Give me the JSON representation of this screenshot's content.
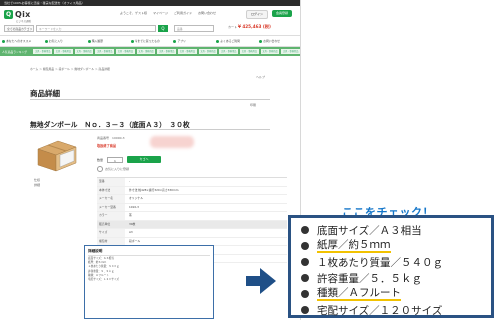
{
  "topbar": {
    "text": "当社で100%お客様に迅速・確実な配送を（オフィス用品）"
  },
  "logo": {
    "mark": "Q",
    "text": "Qix",
    "sub": "ビジネス通販"
  },
  "header": {
    "links": [
      "ようこそ、ゲスト様",
      "マイページ",
      "ご利用ガイド",
      "お問い合わせ"
    ],
    "login": "ログイン",
    "register": "会員登録"
  },
  "search": {
    "category": "全ての商品カテゴリー",
    "placeholder": "キーワードを入力",
    "button": "Q",
    "number_placeholder": "品番"
  },
  "cart": {
    "label": "カート",
    "amount": "¥ 425,463 (税)"
  },
  "nav": [
    "あなたへのオススメ",
    "お気に入り",
    "購入履歴",
    "今までに買ったもの",
    "アプリ",
    "よくあるご質問",
    "お問い合わせ"
  ],
  "categories": {
    "first": "人気商品ランキング",
    "items": [
      "文具・事務用品",
      "文具・事務用品",
      "文具・事務用品",
      "文具・事務用品",
      "文具・事務用品",
      "文具・事務用品",
      "文具・事務用品",
      "文具・事務用品",
      "文具・事務用品",
      "文具・事務用品",
      "文具・事務用品",
      "文具・事務用品",
      "文具・事務用品"
    ]
  },
  "breadcrumb": "ホーム ＞ 梱包用品 ＞ 段ボール ＞ 無地ダンボール ＞ 商品詳細",
  "help": "ヘルプ",
  "page_title": "商品詳細",
  "print_link": "印刷",
  "product": {
    "name": "無地ダンボール　Ｎｏ．３－３（底面Ａ３）　３０枚",
    "code_label": "商品番号",
    "code": "10000-3",
    "status": "取扱終了商品",
    "qty_label": "数量",
    "qty": "1",
    "cart_button": "カゴへ",
    "favorite": "お気に入りに登録",
    "table_label": "仕様",
    "table_label2": "詳細"
  },
  "specs": [
    {
      "k": "型番",
      "v": "-"
    },
    {
      "k": "本体寸法",
      "v": "外寸法 幅428×奥行320×高さ330mm"
    },
    {
      "k": "メーカー名",
      "v": "オリジナル"
    },
    {
      "k": "メーカー型番",
      "v": "1010-3"
    },
    {
      "k": "カラー",
      "v": "茶"
    },
    {
      "k": "販売単位",
      "v": "30枚"
    },
    {
      "k": "サイズ",
      "v": "A3"
    },
    {
      "k": "梱包材",
      "v": "段ボール"
    },
    {
      "k": "お届け日",
      "v": "翌日～"
    },
    {
      "k": "配送",
      "v": "通常配送"
    }
  ],
  "detail": {
    "title": "詳細説明",
    "lines": [
      "底面サイズ：Ａ３相当",
      "紙厚：約５ｍｍ",
      "１枚あたり質量：５４０ｇ",
      "許容重量：５．５ｋｇ",
      "種類：Ａフルート",
      "宅配サイズ：１２０サイズ"
    ]
  },
  "callout": {
    "title": "ここをチェック！",
    "items": [
      {
        "text": "底面サイズ／Ａ３相当",
        "highlight": false
      },
      {
        "text": "紙厚／約５ｍｍ",
        "highlight": true
      },
      {
        "text": "１枚あたり質量／５４０ｇ",
        "highlight": false
      },
      {
        "text": "許容重量／５．５ｋｇ",
        "highlight": false
      },
      {
        "text": "種類／Ａフルート",
        "highlight": true
      },
      {
        "text": "宅配サイズ／１２０サイズ",
        "highlight": false
      }
    ]
  },
  "colors": {
    "accent": "#1aa34a",
    "callout_border": "#2a5283",
    "callout_title": "#1476c9",
    "highlight": "#f2c200",
    "status": "#d93b2b"
  }
}
